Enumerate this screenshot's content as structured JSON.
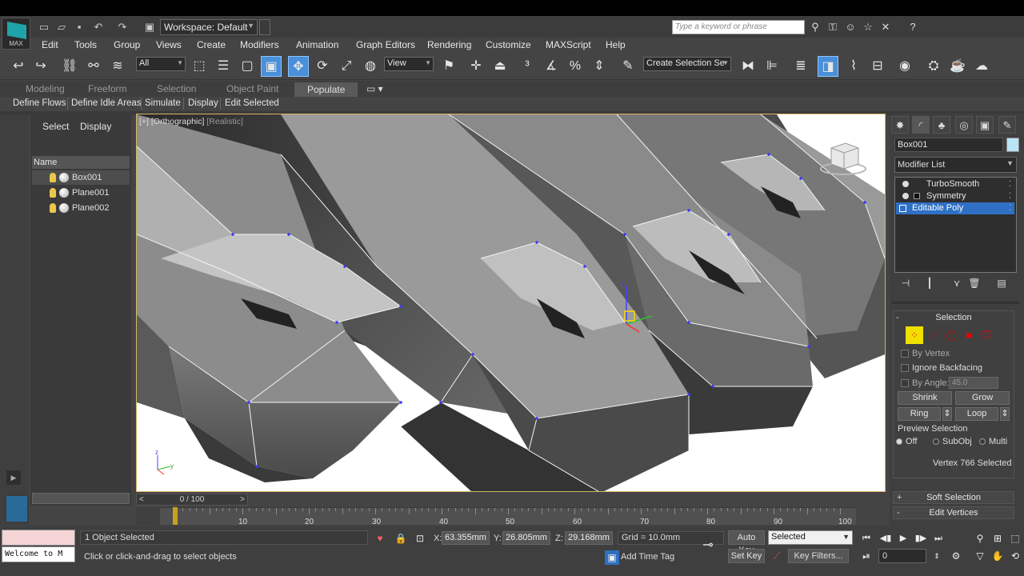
{
  "app": {
    "logo_text": "MAX",
    "workspace": "Workspace: Default",
    "search_placeholder": "Type a keyword or phrase"
  },
  "menu": [
    "Edit",
    "Tools",
    "Group",
    "Views",
    "Create",
    "Modifiers",
    "Animation",
    "Graph Editors",
    "Rendering",
    "Customize",
    "MAXScript",
    "Help"
  ],
  "toolbar": {
    "filter": "All",
    "ref_coord": "View",
    "selection_set": "Create Selection Se"
  },
  "ribbon": {
    "tabs": [
      "Modeling",
      "Freeform",
      "Selection",
      "Object Paint",
      "Populate"
    ],
    "active": "Populate"
  },
  "populate_bar": [
    "Define Flows",
    "Define Idle Areas",
    "Simulate",
    "Display",
    "Edit Selected"
  ],
  "scene_explorer": {
    "tabs": [
      "Select",
      "Display"
    ],
    "column": "Name",
    "items": [
      {
        "name": "Box001",
        "selected": true
      },
      {
        "name": "Plane001",
        "selected": false
      },
      {
        "name": "Plane002",
        "selected": false
      }
    ]
  },
  "viewport": {
    "label_bracket": "[+]",
    "view": "[Orthographic]",
    "shading": "[Realistic]"
  },
  "command_panel": {
    "object_name": "Box001",
    "object_color": "#b8e4f5",
    "modifier_list": "Modifier List",
    "stack": [
      {
        "name": "TurboSmooth",
        "selected": false
      },
      {
        "name": "Symmetry",
        "selected": false
      },
      {
        "name": "Editable Poly",
        "selected": true
      }
    ],
    "selection_rollout": {
      "title": "Selection",
      "by_vertex": "By Vertex",
      "ignore_backfacing": "Ignore Backfacing",
      "by_angle": "By Angle:",
      "angle_value": "45.0",
      "shrink": "Shrink",
      "grow": "Grow",
      "ring": "Ring",
      "loop": "Loop",
      "preview_title": "Preview Selection",
      "preview_options": [
        "Off",
        "SubObj",
        "Multi"
      ],
      "preview_selected": "Off",
      "status": "Vertex 766 Selected"
    },
    "soft_selection": "Soft Selection",
    "edit_vertices": "Edit Vertices"
  },
  "timeline": {
    "frame_display": "0 / 100",
    "ticks": [
      "10",
      "20",
      "30",
      "40",
      "50",
      "60",
      "70",
      "80",
      "90",
      "100"
    ],
    "current_frame": 0
  },
  "status": {
    "welcome": "Welcome to M",
    "selected": "1 Object Selected",
    "prompt": "Click or click-and-drag to select objects",
    "x": "63.355mm",
    "y": "26.805mm",
    "z": "29.168mm",
    "grid": "Grid = 10.0mm",
    "add_time_tag": "Add Time Tag",
    "auto_key": "Auto Key",
    "set_key": "Set Key",
    "key_mode": "Selected",
    "key_filters": "Key Filters...",
    "frame": "0"
  }
}
